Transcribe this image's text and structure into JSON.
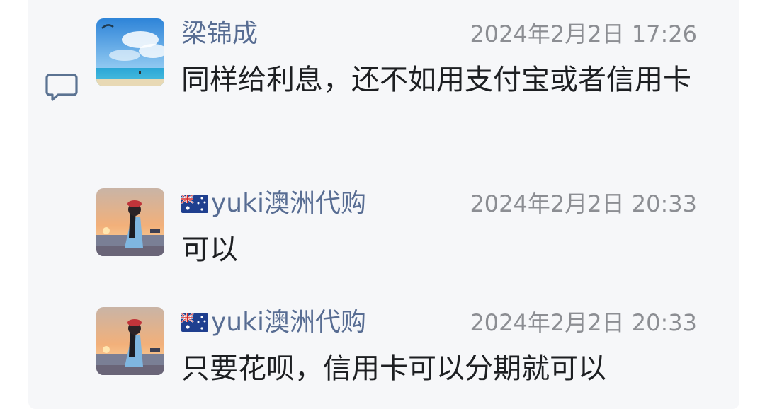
{
  "comments": [
    {
      "author": "梁锦成",
      "time": "2024年2月2日 17:26",
      "text": "同样给利息，还不如用支付宝或者信用卡",
      "avatar": "beach-kite-avatar",
      "flag": null
    },
    {
      "author": "yuki澳洲代购",
      "time": "2024年2月2日 20:33",
      "text": "可以",
      "avatar": "girl-sunset-avatar",
      "flag": "australia-flag-icon"
    },
    {
      "author": "yuki澳洲代购",
      "time": "2024年2月2日 20:33",
      "text": "只要花呗，信用卡可以分期就可以",
      "avatar": "girl-sunset-avatar",
      "flag": "australia-flag-icon"
    }
  ],
  "icons": {
    "comment": "comment-bubble-icon"
  },
  "colors": {
    "panel_background": "#f6f7f9",
    "author_name": "#586d93",
    "timestamp": "#8c8e93",
    "message_text": "#1d1f22",
    "comment_icon": "#5b7392"
  }
}
